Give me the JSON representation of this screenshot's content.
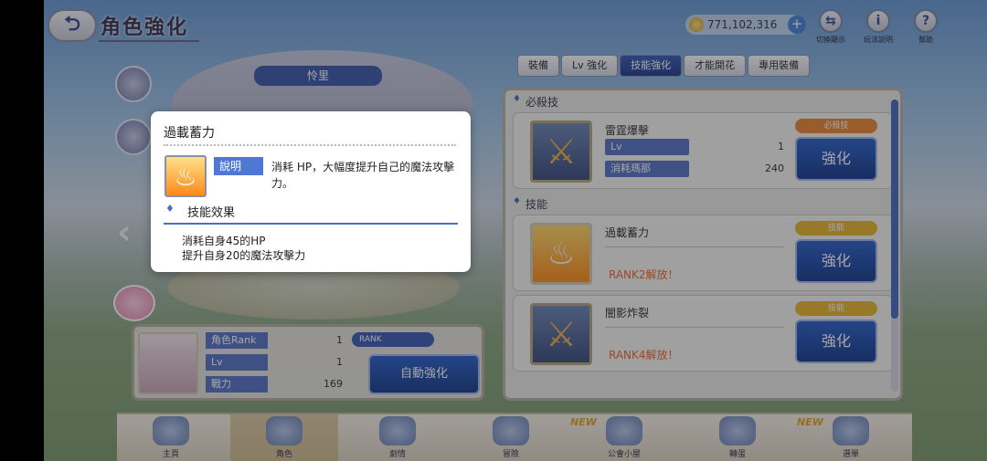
{
  "header": {
    "title": "角色強化",
    "back_label": "⮌"
  },
  "currency": {
    "amount": "771,102,316",
    "plus": "+"
  },
  "top_icons": [
    {
      "label": "切換顯示",
      "glyph": "⇆"
    },
    {
      "label": "玩法說明",
      "glyph": "i"
    },
    {
      "label": "幫助",
      "glyph": "?"
    }
  ],
  "tabs": [
    "裝備",
    "Lv 強化",
    "技能強化",
    "才能開花",
    "專用裝備"
  ],
  "active_tab": 2,
  "character_name": "怜里",
  "right_panel": {
    "ult_header": "必殺技",
    "skill_header": "技能",
    "cards": [
      {
        "name": "雷霆爆擊",
        "badge": "必殺技",
        "badge_type": "ult",
        "lv_label": "Lv",
        "lv_value": "1",
        "cost_label": "消耗瑪那",
        "cost_value": "240",
        "button": "強化",
        "rank_note": "",
        "icon": "⚔"
      },
      {
        "name": "過載蓄力",
        "badge": "技能",
        "badge_type": "norm",
        "button": "強化",
        "rank_note": "RANK2解放！",
        "icon": "♨"
      },
      {
        "name": "闇影炸裂",
        "badge": "技能",
        "badge_type": "norm",
        "button": "強化",
        "rank_note": "RANK4解放！",
        "icon": "⚔"
      }
    ]
  },
  "char_panel": {
    "rows": [
      {
        "label": "角色Rank",
        "value": "1"
      },
      {
        "label": "Lv",
        "value": "1"
      },
      {
        "label": "戰力",
        "value": "169"
      }
    ],
    "rank_pill": "RANK",
    "auto_button": "自動強化"
  },
  "bottom_nav": [
    {
      "label": "主頁",
      "new": false
    },
    {
      "label": "角色",
      "new": false
    },
    {
      "label": "劇情",
      "new": false
    },
    {
      "label": "冒險",
      "new": false
    },
    {
      "label": "公會小屋",
      "new": true
    },
    {
      "label": "轉蛋",
      "new": false
    },
    {
      "label": "選單",
      "new": true
    }
  ],
  "new_tag": "NEW",
  "popup": {
    "title": "過載蓄力",
    "tag": "說明",
    "description": "消耗 HP，大幅度提升自己的魔法攻擊力。",
    "section": "技能效果",
    "effects": [
      "消耗自身45的HP",
      "提升自身20的魔法攻擊力"
    ],
    "icon": "♨"
  }
}
